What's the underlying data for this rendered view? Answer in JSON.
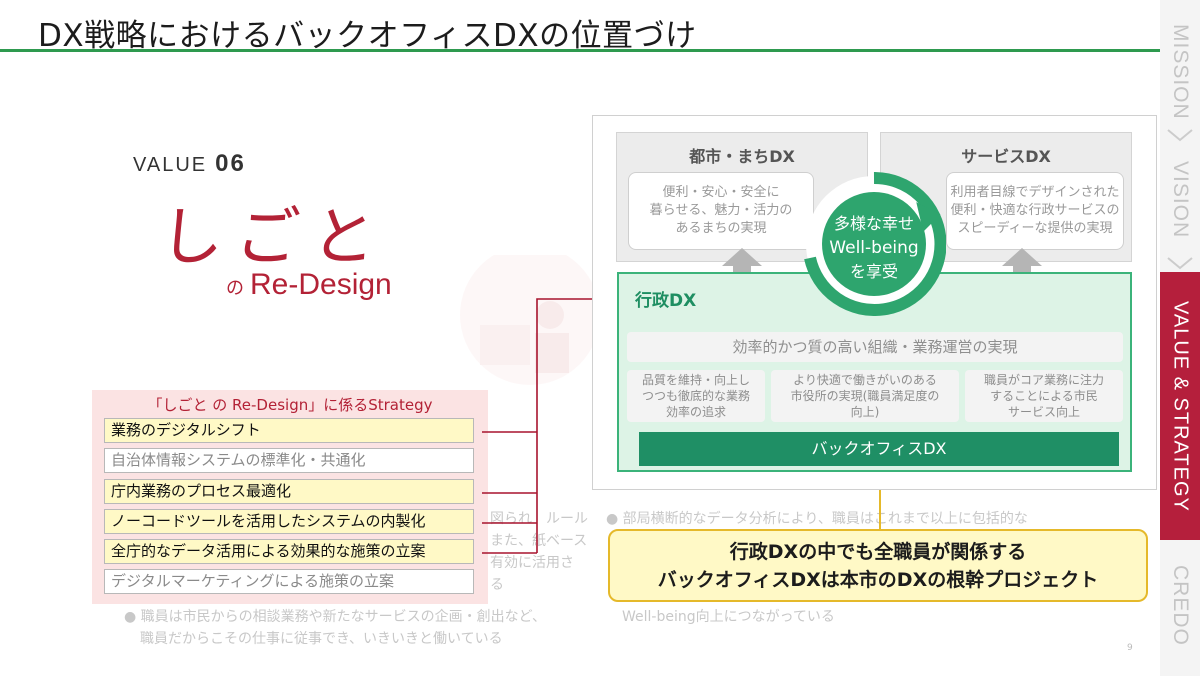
{
  "title": "DX戦略におけるバックオフィスDXの位置づけ",
  "sidenav": {
    "items": [
      {
        "label": "MISSION",
        "active": false
      },
      {
        "label": "VISION",
        "active": false
      },
      {
        "label": "VALUE & STRATEGY",
        "active": true
      },
      {
        "label": "CREDO",
        "active": false
      }
    ]
  },
  "value": {
    "label": "VALUE",
    "number": "06",
    "heading": "しごと",
    "no": "の",
    "subheading": "Re-Design"
  },
  "strategy": {
    "header": "「しごと の Re-Design」に係るStrategy",
    "items": [
      {
        "label": "業務のデジタルシフト",
        "highlight": true
      },
      {
        "label": "自治体情報システムの標準化・共通化",
        "highlight": false
      },
      {
        "label": "庁内業務のプロセス最適化",
        "highlight": true
      },
      {
        "label": "ノーコードツールを活用したシステムの内製化",
        "highlight": true
      },
      {
        "label": "全庁的なデータ活用による効果的な施策の立案",
        "highlight": true
      },
      {
        "label": "デジタルマーケティングによる施策の立案",
        "highlight": false
      }
    ]
  },
  "ghost_text": {
    "a1": "図られ　ルール",
    "a2": "また、紙ベース",
    "a3": "有効に活用さ",
    "a4": "る",
    "b1": "職員は市民からの相談業務や新たなサービスの企画・創出など、",
    "b2": "職員だからこその仕事に従事でき、いきいきと働いている",
    "c1": "部局横断的なデータ分析により、職員はこれまで以上に包括的な",
    "c2": "Well-being向上につながっている"
  },
  "diagram": {
    "city_dx": {
      "title": "都市・まちDX",
      "text": [
        "便利・安心・安全に",
        "暮らせる、魅力・活力の",
        "あるまちの実現"
      ]
    },
    "service_dx": {
      "title": "サービスDX",
      "text": [
        "利用者目線でデザインされた",
        "便利・快適な行政サービスの",
        "スピーディーな提供の実現"
      ]
    },
    "wellbeing": [
      "多様な幸せ",
      "Well-being",
      "を享受"
    ],
    "gyosei_dx": {
      "title": "行政DX",
      "efficiency": "効率的かつ質の高い組織・業務運営の実現",
      "boxes": [
        [
          "品質を維持・向上し",
          "つつも徹底的な業務",
          "効率の追求"
        ],
        [
          "より快適で働きがいのある",
          "市役所の実現(職員満足度の",
          "向上)"
        ],
        [
          "職員がコア業務に注力",
          "することによる市民",
          "サービス向上"
        ]
      ],
      "backoffice": "バックオフィスDX"
    }
  },
  "callout": {
    "line1": "行政DXの中でも全職員が関係する",
    "line2": "バックオフィスDXは本市のDXの根幹プロジェクト"
  },
  "colors": {
    "accent_red": "#b32236",
    "nav_active": "#b51f3c",
    "green": "#1f8f65",
    "title_rule": "#2e9a4f",
    "highlight_yellow": "#fff9c6",
    "callout_border": "#e5b92a"
  },
  "page_number": "9"
}
